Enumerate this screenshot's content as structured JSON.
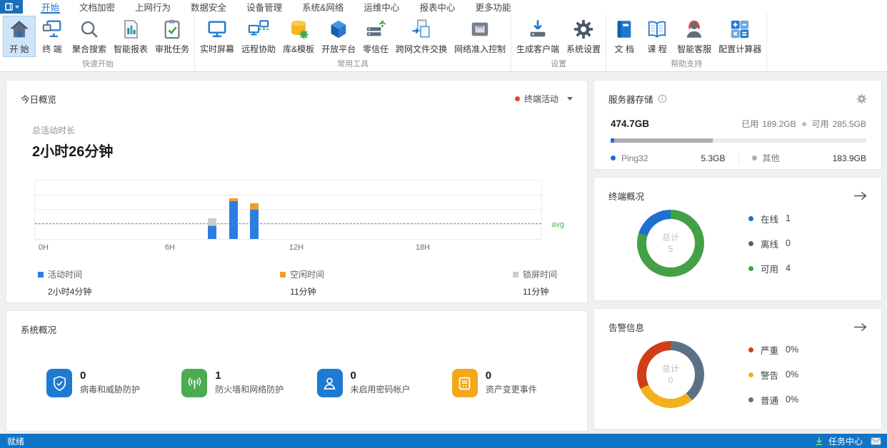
{
  "menubar": {
    "app_button_icon": "app-window-icon",
    "tabs": [
      {
        "label": "开始",
        "active": true
      },
      {
        "label": "文档加密"
      },
      {
        "label": "上网行为"
      },
      {
        "label": "数据安全"
      },
      {
        "label": "设备管理"
      },
      {
        "label": "系统&网络"
      },
      {
        "label": "运维中心"
      },
      {
        "label": "报表中心"
      },
      {
        "label": "更多功能"
      }
    ]
  },
  "ribbon": {
    "groups": [
      {
        "label": "快速开始",
        "buttons": [
          {
            "label": "开 始",
            "icon": "home",
            "active": true
          },
          {
            "label": "终 端",
            "icon": "terminal-monitor"
          },
          {
            "label": "聚合搜索",
            "icon": "search"
          },
          {
            "label": "智能报表",
            "icon": "smart-report"
          },
          {
            "label": "审批任务",
            "icon": "approval-clipboard"
          }
        ]
      },
      {
        "label": "常用工具",
        "buttons": [
          {
            "label": "实时屏幕",
            "icon": "live-screen"
          },
          {
            "label": "远程协助",
            "icon": "remote-assist"
          },
          {
            "label": "库&模板",
            "icon": "library-template"
          },
          {
            "label": "开放平台",
            "icon": "open-platform"
          },
          {
            "label": "零信任",
            "icon": "zero-trust"
          },
          {
            "label": "跨网文件交换",
            "icon": "file-exchange"
          },
          {
            "label": "网络准入控制",
            "icon": "network-access"
          }
        ]
      },
      {
        "label": "设置",
        "buttons": [
          {
            "label": "生成客户端",
            "icon": "generate-client"
          },
          {
            "label": "系统设置",
            "icon": "system-settings"
          }
        ]
      },
      {
        "label": "帮助支持",
        "buttons": [
          {
            "label": "文 档",
            "icon": "docs-book"
          },
          {
            "label": "课 程",
            "icon": "course-book"
          },
          {
            "label": "智能客服",
            "icon": "support-agent"
          },
          {
            "label": "配置计算器",
            "icon": "config-calculator"
          }
        ]
      }
    ]
  },
  "overview_card": {
    "title": "今日概览",
    "dropdown": {
      "label": "终端活动",
      "dot_color": "#e8452c"
    },
    "metric_label": "总活动时长",
    "metric_value": "2小时26分钟"
  },
  "chart_data": {
    "type": "bar",
    "stacked": true,
    "title": "终端活动",
    "x_unit": "hour",
    "x_range_hours": 24,
    "x_ticks": [
      {
        "hour": 0,
        "label": "0H"
      },
      {
        "hour": 6,
        "label": "6H"
      },
      {
        "hour": 12,
        "label": "12H"
      },
      {
        "hour": 18,
        "label": "18H"
      }
    ],
    "ylim_minutes": [
      0,
      95
    ],
    "grid": "dotted-horizontal-25-50-75",
    "bars": [
      {
        "hour": 8,
        "segments_minutes": {
          "active": 20,
          "idle": 2,
          "locked": 11
        }
      },
      {
        "hour": 9,
        "segments_minutes": {
          "active": 60,
          "idle": 5,
          "locked": 0
        }
      },
      {
        "hour": 10,
        "segments_minutes": {
          "active": 46,
          "idle": 11,
          "locked": 0
        }
      }
    ],
    "series_order": [
      "active",
      "idle",
      "locked"
    ],
    "series_meta": {
      "active": {
        "label": "活动时间",
        "total": "2小时4分钟",
        "color": "#2c7de0"
      },
      "idle": {
        "label": "空闲时间",
        "total": "11分钟",
        "color": "#f49d25"
      },
      "locked": {
        "label": "锁屏时间",
        "total": "11分钟",
        "color": "#c9ccd1"
      }
    },
    "avg_line": {
      "label": "avg",
      "value_minutes": 24,
      "color": "#54b154"
    }
  },
  "storage_card": {
    "title": "服务器存储",
    "info_icon": "info-circle",
    "settings_icon": "gear",
    "total": "474.7GB",
    "used_label": "已用",
    "used": "189.2GB",
    "free_label": "可用",
    "free": "285.5GB",
    "bar": {
      "track_color": "#e9ebee",
      "segments": [
        {
          "name": "Ping32",
          "pct": 1.4,
          "color": "#1f6fd0"
        },
        {
          "name": "其他",
          "pct": 38.5,
          "color": "#a9aeb4"
        }
      ]
    },
    "legend": [
      {
        "label": "Ping32",
        "value": "5.3GB",
        "dot_color": "#1f6fd0"
      },
      {
        "label": "其他",
        "value": "183.9GB",
        "dot_color": "#a9aeb4"
      }
    ]
  },
  "terminal_card": {
    "title": "终端概况",
    "arrow_icon": "arrow-right",
    "donut": {
      "center_label": "总计",
      "center_value": "5",
      "arcs": [
        {
          "name": "可用",
          "deg": 288,
          "color": "#43a047"
        },
        {
          "name": "在线",
          "deg": 72,
          "color": "#1e6fd0"
        }
      ]
    },
    "legend": [
      {
        "label": "在线",
        "value": "1",
        "color": "#1e6fd0"
      },
      {
        "label": "离线",
        "value": "0",
        "color": "#51607a"
      },
      {
        "label": "可用",
        "value": "4",
        "color": "#43a047"
      }
    ]
  },
  "system_card": {
    "title": "系统概况",
    "items": [
      {
        "value": "0",
        "label": "病毒和威胁防护",
        "icon": "shield-check",
        "color": "#1e7ad2"
      },
      {
        "value": "1",
        "label": "防火墙和网络防护",
        "icon": "signal-tower",
        "color": "#4aab50"
      },
      {
        "value": "0",
        "label": "未启用密码帐户",
        "icon": "user-account",
        "color": "#1e7ad2"
      },
      {
        "value": "0",
        "label": "资产变更事件",
        "icon": "asset-device",
        "color": "#f2a819"
      }
    ]
  },
  "alert_card": {
    "title": "告警信息",
    "arrow_icon": "arrow-right",
    "donut": {
      "center_label": "总计",
      "center_value": "0",
      "arcs": [
        {
          "name": "普通",
          "deg": 140,
          "color": "#5d7186"
        },
        {
          "name": "警告",
          "deg": 105,
          "color": "#f2b11c"
        },
        {
          "name": "严重",
          "deg": 115,
          "color": "#d23d17"
        }
      ]
    },
    "legend": [
      {
        "label": "严重",
        "value": "0%",
        "color": "#d23d17"
      },
      {
        "label": "警告",
        "value": "0%",
        "color": "#f2b11c"
      },
      {
        "label": "普通",
        "value": "0%",
        "color": "#5d7186"
      }
    ]
  },
  "statusbar": {
    "left": "就绪",
    "task_center": "任务中心",
    "download_icon": "download-arrow",
    "mail_icon": "mail"
  }
}
